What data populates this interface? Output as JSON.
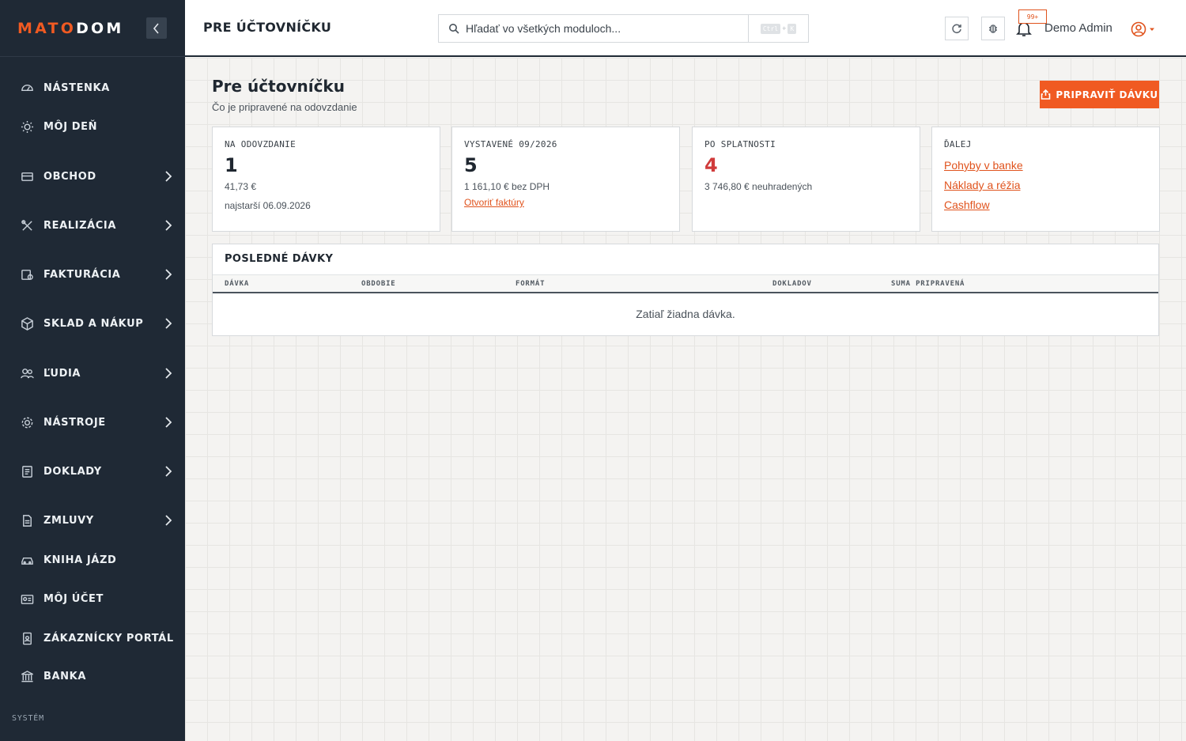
{
  "brand": {
    "logo_part1": "MATO",
    "logo_part2": "DOM"
  },
  "sidebar": {
    "items": [
      {
        "label": "NÁSTENKA",
        "icon": "gauge-icon",
        "has_children": false
      },
      {
        "label": "MÔJ DEŇ",
        "icon": "sun-icon",
        "has_children": false
      },
      {
        "label": "OBCHOD",
        "icon": "inbox-icon",
        "has_children": true
      },
      {
        "label": "REALIZÁCIA",
        "icon": "tools-icon",
        "has_children": true
      },
      {
        "label": "FAKTURÁCIA",
        "icon": "invoice-icon",
        "has_children": true
      },
      {
        "label": "SKLAD A NÁKUP",
        "icon": "box-icon",
        "has_children": true
      },
      {
        "label": "ĽUDIA",
        "icon": "users-icon",
        "has_children": true
      },
      {
        "label": "NÁSTROJE",
        "icon": "gear-icon",
        "has_children": true
      },
      {
        "label": "DOKLADY",
        "icon": "document-icon",
        "has_children": true
      },
      {
        "label": "ZMLUVY",
        "icon": "contract-icon",
        "has_children": true
      },
      {
        "label": "KNIHA JÁZD",
        "icon": "car-icon",
        "has_children": false
      },
      {
        "label": "MÔJ ÚČET",
        "icon": "id-card-icon",
        "has_children": false
      },
      {
        "label": "ZÁKAZNÍCKY PORTÁL",
        "icon": "portal-icon",
        "has_children": false
      },
      {
        "label": "BANKA",
        "icon": "bank-icon",
        "has_children": false
      }
    ],
    "section_label": "SYSTÉM"
  },
  "header": {
    "title": "PRE ÚČTOVNÍČKU",
    "search_placeholder": "Hľadať vo všetkých moduloch...",
    "shortcut_key1": "Ctrl",
    "shortcut_plus": "+",
    "shortcut_key2": "K",
    "notification_count": "99+",
    "user_name": "Demo Admin"
  },
  "page": {
    "title": "Pre účtovníčku",
    "subtitle": "Čo je pripravené na odovzdanie",
    "primary_button": "PRIPRAVIŤ DÁVKU"
  },
  "cards": {
    "handover": {
      "label": "NA ODOVZDANIE",
      "value": "1",
      "amount": "41,73 €",
      "oldest": "najstarší 06.09.2026"
    },
    "issued": {
      "label": "VYSTAVENÉ 09/2026",
      "value": "5",
      "amount": "1 161,10 € bez DPH",
      "link": "Otvoriť faktúry"
    },
    "overdue": {
      "label": "PO SPLATNOSTI",
      "value": "4",
      "amount": "3 746,80 € neuhradených"
    },
    "next": {
      "label": "ĎALEJ",
      "links": [
        "Pohyby v banke",
        "Náklady a réžia",
        "Cashflow"
      ]
    }
  },
  "batches": {
    "title": "POSLEDNÉ DÁVKY",
    "columns": [
      "DÁVKA",
      "OBDOBIE",
      "FORMÁT",
      "DOKLADOV",
      "SUMA PRIPRAVENÁ"
    ],
    "empty_text": "Zatiaľ žiadna dávka."
  },
  "colors": {
    "accent": "#f05a22",
    "sidebar_bg": "#1f2935",
    "danger": "#d03b3b"
  }
}
